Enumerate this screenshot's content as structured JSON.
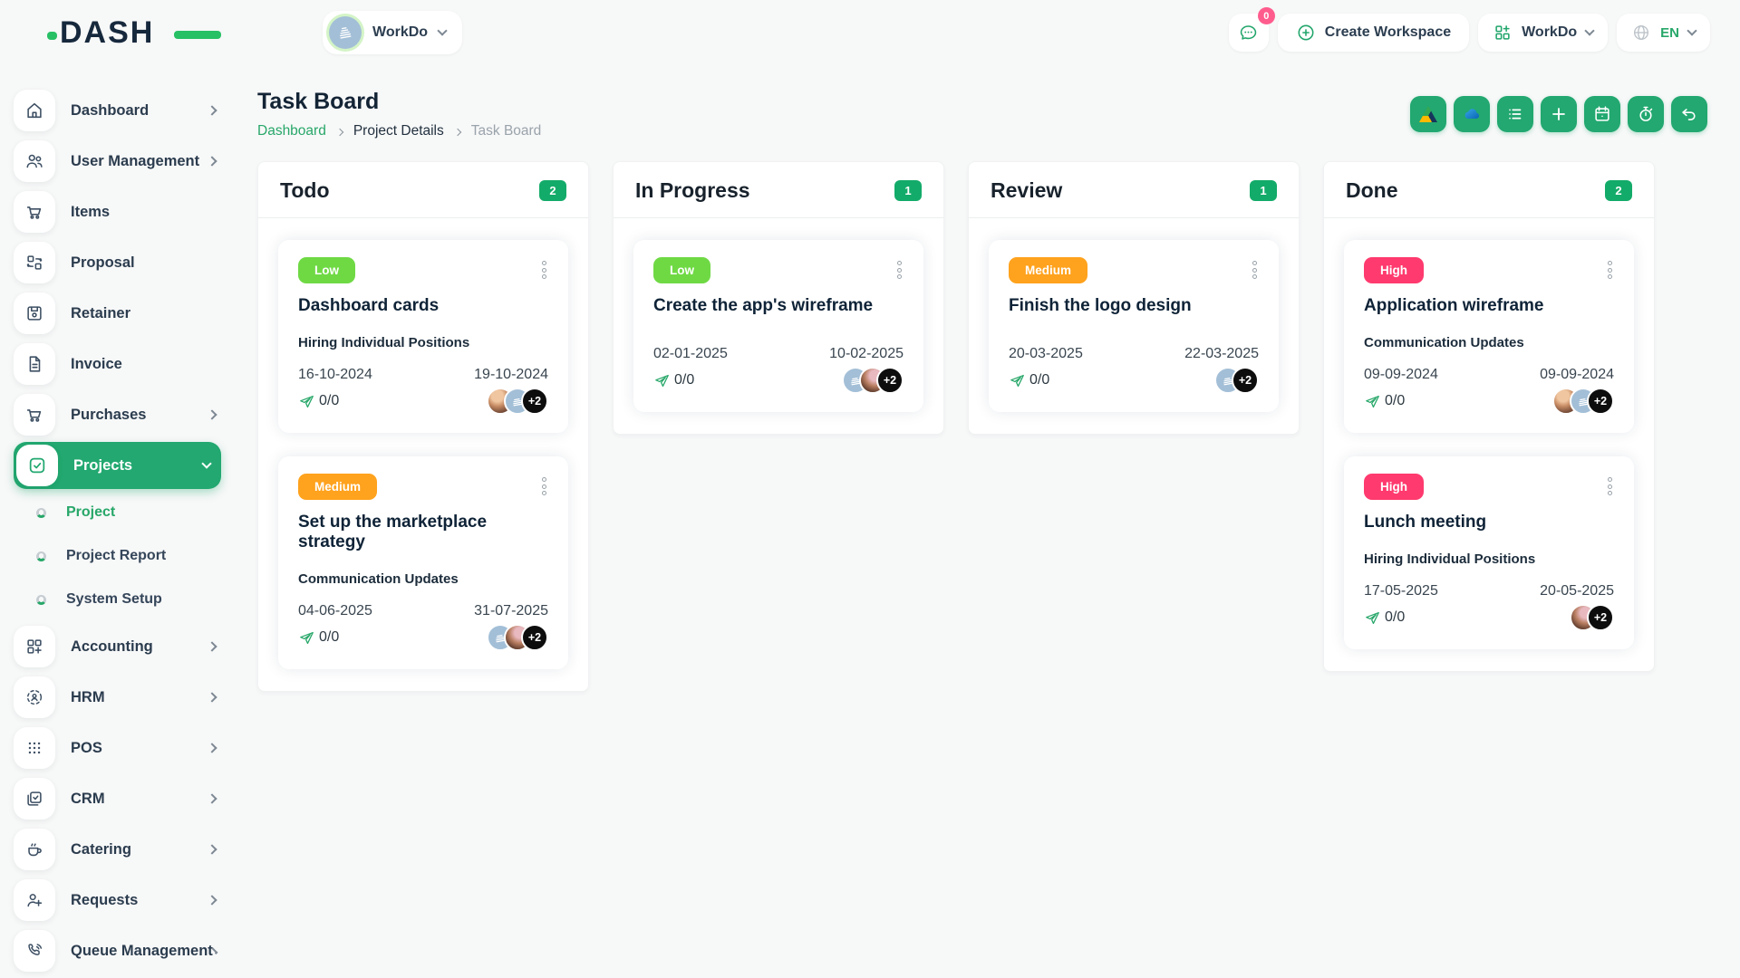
{
  "brand": {
    "name": "DASH"
  },
  "header": {
    "workspace_selector": {
      "label": "WorkDo"
    },
    "messages_badge": "0",
    "create_workspace_label": "Create Workspace",
    "workdo_menu_label": "WorkDo",
    "language_code": "EN"
  },
  "sidebar": {
    "items": [
      {
        "label": "Dashboard",
        "icon": "home-icon",
        "has_submenu": true
      },
      {
        "label": "User Management",
        "icon": "users-icon",
        "has_submenu": true
      },
      {
        "label": "Items",
        "icon": "cart-icon",
        "has_submenu": false
      },
      {
        "label": "Proposal",
        "icon": "proposal-icon",
        "has_submenu": false
      },
      {
        "label": "Retainer",
        "icon": "save-icon",
        "has_submenu": false
      },
      {
        "label": "Invoice",
        "icon": "invoice-icon",
        "has_submenu": false
      },
      {
        "label": "Purchases",
        "icon": "cart-icon",
        "has_submenu": true
      },
      {
        "label": "Projects",
        "icon": "check-square-icon",
        "has_submenu": true,
        "active": true,
        "expanded": true,
        "children": [
          {
            "label": "Project",
            "active": true
          },
          {
            "label": "Project Report",
            "active": false
          },
          {
            "label": "System Setup",
            "active": false
          }
        ]
      },
      {
        "label": "Accounting",
        "icon": "grid-plus-icon",
        "has_submenu": true
      },
      {
        "label": "HRM",
        "icon": "hrm-icon",
        "has_submenu": true
      },
      {
        "label": "POS",
        "icon": "dots-grid-icon",
        "has_submenu": true
      },
      {
        "label": "CRM",
        "icon": "crm-icon",
        "has_submenu": true
      },
      {
        "label": "Catering",
        "icon": "coffee-icon",
        "has_submenu": true
      },
      {
        "label": "Requests",
        "icon": "user-plus-icon",
        "has_submenu": true
      },
      {
        "label": "Queue Management",
        "icon": "phone-icon",
        "has_submenu": true
      }
    ]
  },
  "page": {
    "title": "Task Board",
    "breadcrumb": [
      {
        "label": "Dashboard",
        "type": "link"
      },
      {
        "label": "Project Details",
        "type": "text"
      },
      {
        "label": "Task Board",
        "type": "current"
      }
    ]
  },
  "toolbar": {
    "buttons": [
      {
        "name": "google-drive"
      },
      {
        "name": "onedrive"
      },
      {
        "name": "list"
      },
      {
        "name": "add"
      },
      {
        "name": "calendar"
      },
      {
        "name": "timer"
      },
      {
        "name": "undo"
      }
    ]
  },
  "board": {
    "columns": [
      {
        "title": "Todo",
        "count": "2",
        "cards": [
          {
            "priority": "Low",
            "priority_color": "#6fd944",
            "title": "Dashboard cards",
            "milestone": "Hiring Individual Positions",
            "start_date": "16-10-2024",
            "end_date": "19-10-2024",
            "progress": "0/0",
            "avatars": [
              "photo",
              "workspace"
            ],
            "overflow": "+2"
          },
          {
            "priority": "Medium",
            "priority_color": "#ffa21d",
            "title": "Set up the marketplace strategy",
            "milestone": "Communication Updates",
            "start_date": "04-06-2025",
            "end_date": "31-07-2025",
            "progress": "0/0",
            "avatars": [
              "workspace",
              "photo"
            ],
            "overflow": "+2"
          }
        ]
      },
      {
        "title": "In Progress",
        "count": "1",
        "cards": [
          {
            "priority": "Low",
            "priority_color": "#6fd944",
            "title": "Create the app's wireframe",
            "milestone": "",
            "start_date": "02-01-2025",
            "end_date": "10-02-2025",
            "progress": "0/0",
            "avatars": [
              "workspace",
              "photo"
            ],
            "overflow": "+2"
          }
        ]
      },
      {
        "title": "Review",
        "count": "1",
        "cards": [
          {
            "priority": "Medium",
            "priority_color": "#ffa21d",
            "title": "Finish the logo design",
            "milestone": "",
            "start_date": "20-03-2025",
            "end_date": "22-03-2025",
            "progress": "0/0",
            "avatars": [
              "workspace"
            ],
            "overflow": "+2"
          }
        ]
      },
      {
        "title": "Done",
        "count": "2",
        "cards": [
          {
            "priority": "High",
            "priority_color": "#ff3a6e",
            "title": "Application wireframe",
            "milestone": "Communication Updates",
            "start_date": "09-09-2024",
            "end_date": "09-09-2024",
            "progress": "0/0",
            "avatars": [
              "photo",
              "workspace"
            ],
            "overflow": "+2"
          },
          {
            "priority": "High",
            "priority_color": "#ff3a6e",
            "title": "Lunch meeting",
            "milestone": "Hiring Individual Positions",
            "start_date": "17-05-2025",
            "end_date": "20-05-2025",
            "progress": "0/0",
            "avatars": [
              "photo"
            ],
            "overflow": "+2"
          }
        ]
      }
    ]
  },
  "colors": {
    "theme_green": "#22a870",
    "count_badge_green": "#13ab69",
    "low_green": "#6fd944",
    "medium_orange": "#ffa21d",
    "high_pink": "#ff3a6e",
    "chat_badge_pink": "#ff5c8d",
    "link_green": "#27a769",
    "workspace_avatar_blue": "#a3bfd7"
  }
}
